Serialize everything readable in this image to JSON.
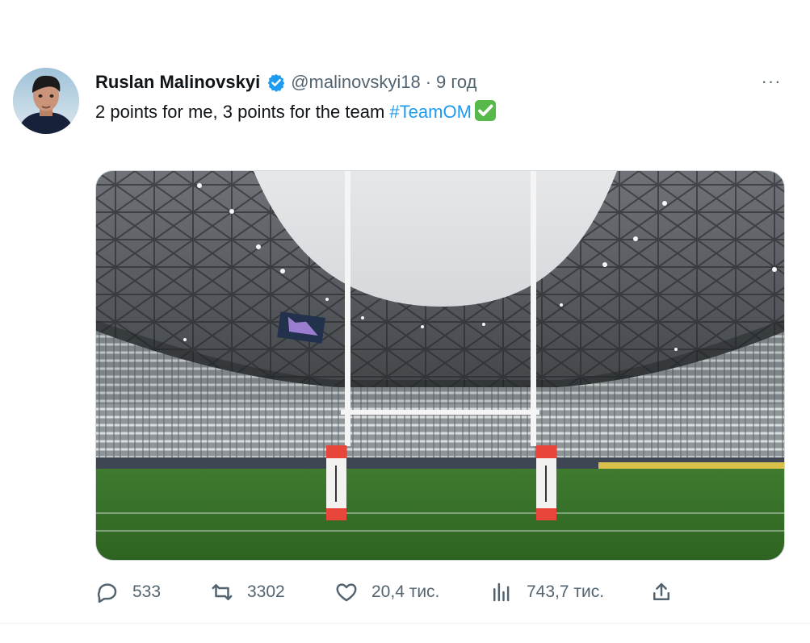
{
  "tweet": {
    "display_name": "Ruslan Malinovskyi",
    "handle": "@malinovskyi18",
    "separator": "·",
    "time": "9 год",
    "text": "2 points for me, 3 points for the team ",
    "hashtag": "#TeamOM",
    "emoji_icon": "white-heavy-check-mark-icon",
    "verified_icon": "verified-badge-icon",
    "more_label": "···"
  },
  "actions": {
    "replies": "533",
    "reposts": "3302",
    "likes": "20,4 тис.",
    "views": "743,7 тис."
  },
  "colors": {
    "accent": "#1d9bf0",
    "secondary_text": "#536471",
    "check_green": "#57b94a"
  }
}
